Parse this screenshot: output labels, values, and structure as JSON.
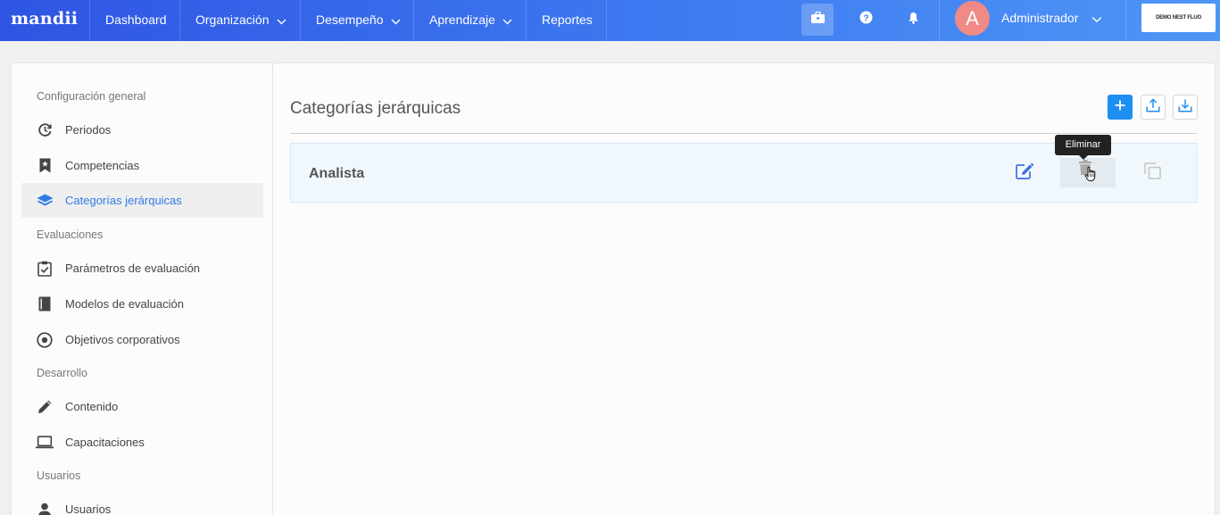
{
  "app": {
    "logo": "mandii"
  },
  "nav": {
    "items": [
      {
        "label": "Dashboard"
      },
      {
        "label": "Organización"
      },
      {
        "label": "Desempeño"
      },
      {
        "label": "Aprendizaje"
      },
      {
        "label": "Reportes"
      }
    ],
    "user": {
      "initial": "A",
      "name": "Administrador"
    },
    "company_logo": "DEMO NEST FLUO"
  },
  "sidebar": {
    "sections": {
      "general": "Configuración general",
      "evaluaciones": "Evaluaciones",
      "desarrollo": "Desarrollo",
      "usuarios": "Usuarios"
    },
    "items": {
      "periodos": "Periodos",
      "competencias": "Competencias",
      "categorias": "Categorías jerárquicas",
      "parametros": "Parámetros de evaluación",
      "modelos": "Modelos de evaluación",
      "objetivos": "Objetivos corporativos",
      "contenido": "Contenido",
      "capacitaciones": "Capacitaciones",
      "usuarios": "Usuarios"
    }
  },
  "page": {
    "title": "Categorías jerárquicas",
    "rows": [
      {
        "label": "Analista"
      }
    ],
    "tooltip": "Eliminar"
  },
  "colors": {
    "primary": "#1f8ef1",
    "nav_start": "#2f54e3",
    "nav_end": "#4f95f5",
    "avatar": "#f08a86"
  }
}
